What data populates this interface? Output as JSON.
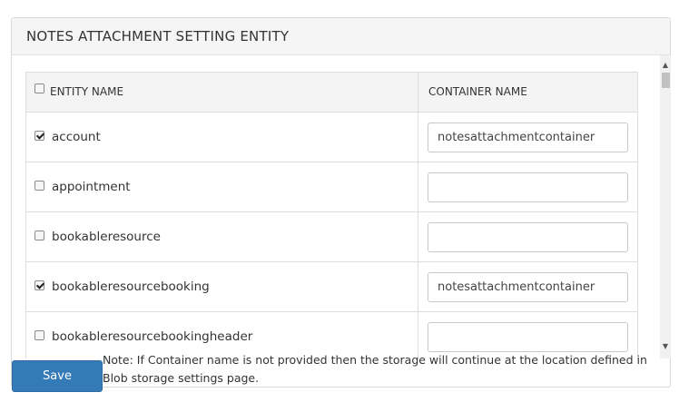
{
  "panel": {
    "title": "NOTES ATTACHMENT SETTING ENTITY"
  },
  "table": {
    "header_entity": "ENTITY NAME",
    "header_container": "CONTAINER NAME",
    "header_checked": false,
    "rows": [
      {
        "entity": "account",
        "checked": true,
        "container": "notesattachmentcontainer"
      },
      {
        "entity": "appointment",
        "checked": false,
        "container": ""
      },
      {
        "entity": "bookableresource",
        "checked": false,
        "container": ""
      },
      {
        "entity": "bookableresourcebooking",
        "checked": true,
        "container": "notesattachmentcontainer"
      },
      {
        "entity": "bookableresourcebookingheader",
        "checked": false,
        "container": ""
      }
    ]
  },
  "scrollbar": {
    "up_icon": "▲",
    "down_icon": "▼"
  },
  "footer": {
    "save_label": "Save",
    "note": "Note: If Container name is not provided then the storage will continue at the location defined in Blob storage settings page."
  }
}
